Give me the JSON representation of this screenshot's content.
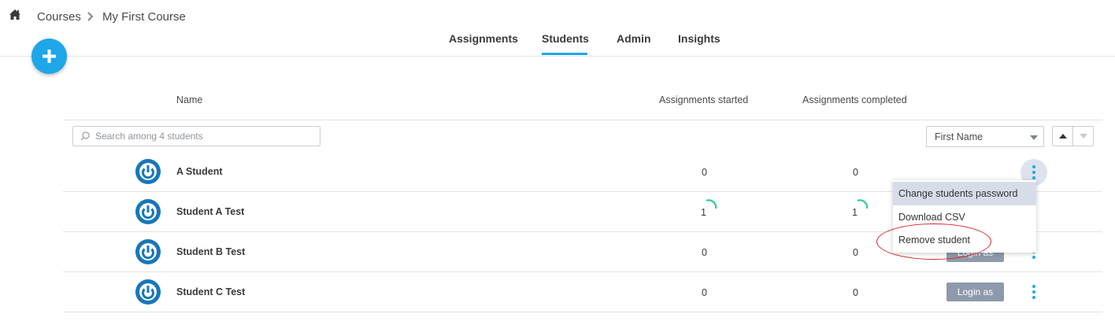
{
  "breadcrumb": {
    "items": [
      "Courses",
      "My First Course"
    ]
  },
  "tabs": [
    {
      "label": "Assignments",
      "active": false
    },
    {
      "label": "Students",
      "active": true
    },
    {
      "label": "Admin",
      "active": false
    },
    {
      "label": "Insights",
      "active": false
    }
  ],
  "table": {
    "columns": [
      "Name",
      "Assignments started",
      "Assignments completed"
    ],
    "search": {
      "placeholder": "Search among 4 students",
      "value": ""
    },
    "sort": {
      "selected": "First Name"
    },
    "rows": [
      {
        "name": "A Student",
        "started": "0",
        "completed": "0",
        "login_label": ""
      },
      {
        "name": "Student A Test",
        "started": "1",
        "completed": "1",
        "login_label": ""
      },
      {
        "name": "Student B Test",
        "started": "0",
        "completed": "0",
        "login_label": "Login as"
      },
      {
        "name": "Student C Test",
        "started": "0",
        "completed": "0",
        "login_label": "Login as"
      }
    ]
  },
  "menu": {
    "items": [
      "Change students password",
      "Download CSV",
      "Remove student"
    ]
  },
  "colors": {
    "accent": "#1ea7e8",
    "progress": "#2ecc9a",
    "annotation": "#d9262a",
    "login_button": "#8e9aab"
  }
}
